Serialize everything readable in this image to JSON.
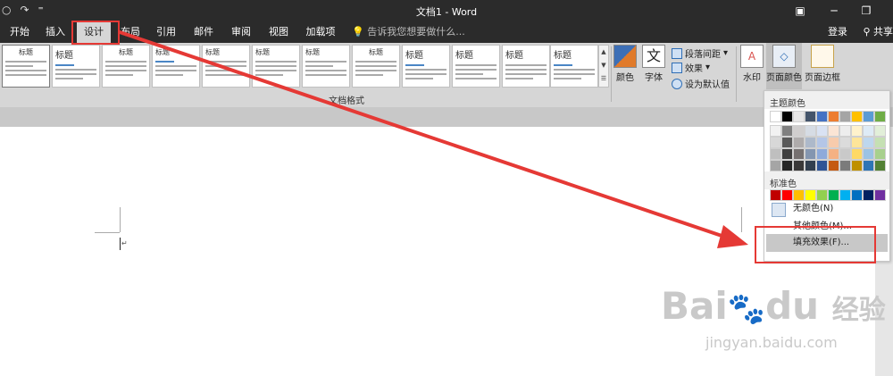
{
  "window": {
    "title": "文档1 - Word",
    "qat_icons": [
      "autosave-icon",
      "redo-icon",
      "customize-qat-icon"
    ],
    "controls": [
      "ribbon-display-icon",
      "minimize-icon",
      "restore-icon"
    ]
  },
  "tabs": {
    "items": [
      {
        "label": "开始"
      },
      {
        "label": "插入"
      },
      {
        "label": "设计",
        "active": true
      },
      {
        "label": "布局"
      },
      {
        "label": "引用"
      },
      {
        "label": "邮件"
      },
      {
        "label": "审阅"
      },
      {
        "label": "视图"
      },
      {
        "label": "加载项"
      }
    ],
    "tell_me": "告诉我您想要做什么...",
    "signin": "登录",
    "share": "共享"
  },
  "ribbon": {
    "gallery_styles": [
      {
        "title": "标题",
        "kind": "first"
      },
      {
        "title": "标题"
      },
      {
        "title": "标题"
      },
      {
        "title": "标题"
      },
      {
        "title": "标题"
      },
      {
        "title": "标题"
      },
      {
        "title": "标题"
      },
      {
        "title": "标题"
      },
      {
        "title": "标题"
      },
      {
        "title": "标题"
      },
      {
        "title": "标题"
      },
      {
        "title": "标题"
      }
    ],
    "group_label_doc_format": "文档格式",
    "colors_label": "颜色",
    "fonts_label": "字体",
    "fonts_glyph": "文",
    "paragraph_spacing": "段落间距",
    "effects": "效果",
    "set_default": "设为默认值",
    "watermark": "水印",
    "page_color": "页面颜色",
    "page_border": "页面边框"
  },
  "page_color_menu": {
    "theme_colors_header": "主题颜色",
    "standard_colors_header": "标准色",
    "no_color": "无颜色(N)",
    "more_colors": "其他颜色(M)...",
    "fill_effects": "填充效果(F)...",
    "theme_top_row": [
      "#ffffff",
      "#000000",
      "#e7e6e6",
      "#44546a",
      "#4472c4",
      "#ed7d31",
      "#a5a5a5",
      "#ffc000",
      "#5b9bd5",
      "#70ad47"
    ],
    "theme_shades": [
      [
        "#f2f2f2",
        "#7f7f7f",
        "#d0cece",
        "#d6dce4",
        "#d9e2f3",
        "#fbe5d5",
        "#ededed",
        "#fff2cc",
        "#deebf6",
        "#e2efd9"
      ],
      [
        "#d8d8d8",
        "#595959",
        "#aeabab",
        "#adb9ca",
        "#b4c6e7",
        "#f7cbac",
        "#dbdbdb",
        "#fee599",
        "#bdd7ee",
        "#c5e0b3"
      ],
      [
        "#bfbfbf",
        "#3f3f3f",
        "#757070",
        "#8496b0",
        "#8eaadb",
        "#f4b183",
        "#c9c9c9",
        "#ffd965",
        "#9cc3e5",
        "#a8d08d"
      ],
      [
        "#a5a5a5",
        "#262626",
        "#3a3838",
        "#323f4f",
        "#2f5496",
        "#c55a11",
        "#7b7b7b",
        "#bf9000",
        "#2e75b5",
        "#538135"
      ],
      [
        "#7f7f7f",
        "#0c0c0c",
        "#171616",
        "#222a35",
        "#1f3864",
        "#833c0b",
        "#525252",
        "#7f6000",
        "#1e4e79",
        "#375623"
      ]
    ],
    "standard": [
      "#c00000",
      "#ff0000",
      "#ffc000",
      "#ffff00",
      "#92d050",
      "#00b050",
      "#00b0f0",
      "#0070c0",
      "#002060",
      "#7030a0"
    ]
  },
  "watermark_text": {
    "brand": "Bai",
    "brand2": "du",
    "cn": "经验",
    "url": "jingyan.baidu.com"
  },
  "colors": {
    "annotation_red": "#e53935"
  }
}
